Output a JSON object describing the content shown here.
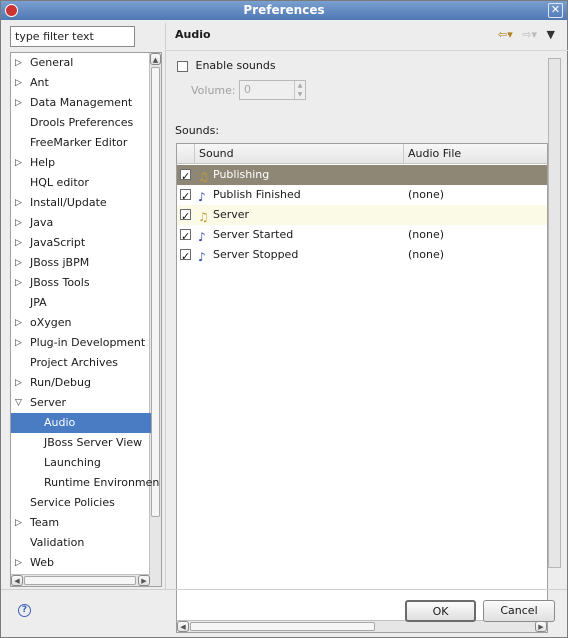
{
  "window": {
    "title": "Preferences"
  },
  "filter": {
    "placeholder": "type filter text"
  },
  "tree": {
    "items": [
      {
        "label": "General",
        "arrow": "▷",
        "child": false
      },
      {
        "label": "Ant",
        "arrow": "▷",
        "child": false
      },
      {
        "label": "Data Management",
        "arrow": "▷",
        "child": false
      },
      {
        "label": "Drools Preferences",
        "arrow": "",
        "child": false
      },
      {
        "label": "FreeMarker Editor",
        "arrow": "",
        "child": false
      },
      {
        "label": "Help",
        "arrow": "▷",
        "child": false
      },
      {
        "label": "HQL editor",
        "arrow": "",
        "child": false
      },
      {
        "label": "Install/Update",
        "arrow": "▷",
        "child": false
      },
      {
        "label": "Java",
        "arrow": "▷",
        "child": false
      },
      {
        "label": "JavaScript",
        "arrow": "▷",
        "child": false
      },
      {
        "label": "JBoss jBPM",
        "arrow": "▷",
        "child": false
      },
      {
        "label": "JBoss Tools",
        "arrow": "▷",
        "child": false
      },
      {
        "label": "JPA",
        "arrow": "",
        "child": false
      },
      {
        "label": "oXygen",
        "arrow": "▷",
        "child": false
      },
      {
        "label": "Plug-in Development",
        "arrow": "▷",
        "child": false
      },
      {
        "label": "Project Archives",
        "arrow": "",
        "child": false
      },
      {
        "label": "Run/Debug",
        "arrow": "▷",
        "child": false
      },
      {
        "label": "Server",
        "arrow": "▽",
        "child": false
      },
      {
        "label": "Audio",
        "arrow": "",
        "child": true,
        "selected": true
      },
      {
        "label": "JBoss Server View",
        "arrow": "",
        "child": true
      },
      {
        "label": "Launching",
        "arrow": "",
        "child": true
      },
      {
        "label": "Runtime Environmen",
        "arrow": "",
        "child": true
      },
      {
        "label": "Service Policies",
        "arrow": "",
        "child": false
      },
      {
        "label": "Team",
        "arrow": "▷",
        "child": false
      },
      {
        "label": "Validation",
        "arrow": "",
        "child": false
      },
      {
        "label": "Web",
        "arrow": "▷",
        "child": false
      }
    ]
  },
  "page": {
    "title": "Audio",
    "enable_sounds_label": "Enable sounds",
    "enable_sounds_checked": false,
    "volume_label": "Volume:",
    "volume_value": "0",
    "sounds_label": "Sounds:"
  },
  "table": {
    "columns": [
      "Sound",
      "Audio File"
    ],
    "rows": [
      {
        "name": "Publishing",
        "file": "",
        "icon": "folder-music-icon",
        "checked": true,
        "state": "selected"
      },
      {
        "name": "Publish Finished",
        "file": "(none)",
        "icon": "music-note-icon",
        "checked": true,
        "state": ""
      },
      {
        "name": "Server",
        "file": "",
        "icon": "folder-music-icon",
        "checked": true,
        "state": "hover"
      },
      {
        "name": "Server Started",
        "file": "(none)",
        "icon": "music-note-icon",
        "checked": true,
        "state": ""
      },
      {
        "name": "Server Stopped",
        "file": "(none)",
        "icon": "music-note-icon",
        "checked": true,
        "state": ""
      }
    ]
  },
  "buttons": {
    "ok": "OK",
    "cancel": "Cancel"
  },
  "colors": {
    "selection": "#4a7cc4",
    "row_selected": "#8e8776",
    "row_hover": "#fbfae6",
    "titlebar": "#5b82bc"
  }
}
